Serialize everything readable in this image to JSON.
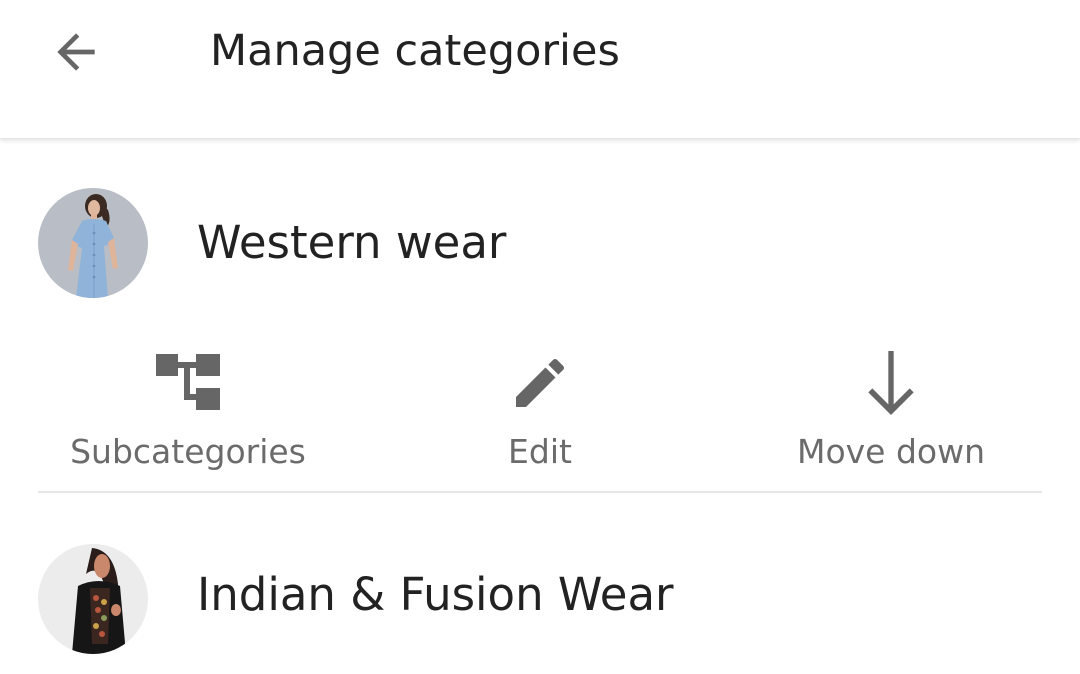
{
  "header": {
    "title": "Manage categories",
    "back_icon": "arrow-back-icon"
  },
  "categories": [
    {
      "name": "Western wear",
      "image": "woman-in-light-blue-dress"
    },
    {
      "name": "Indian & Fusion Wear",
      "image": "woman-in-black-embroidered-kurta"
    }
  ],
  "actions": [
    {
      "label": "Subcategories",
      "icon": "subcategories-tree-icon"
    },
    {
      "label": "Edit",
      "icon": "pencil-icon"
    },
    {
      "label": "Move down",
      "icon": "arrow-down-icon"
    }
  ],
  "colors": {
    "title_text": "#222222",
    "action_text": "#6b6b6b",
    "icon": "#666666",
    "divider": "#e6e6e6"
  }
}
